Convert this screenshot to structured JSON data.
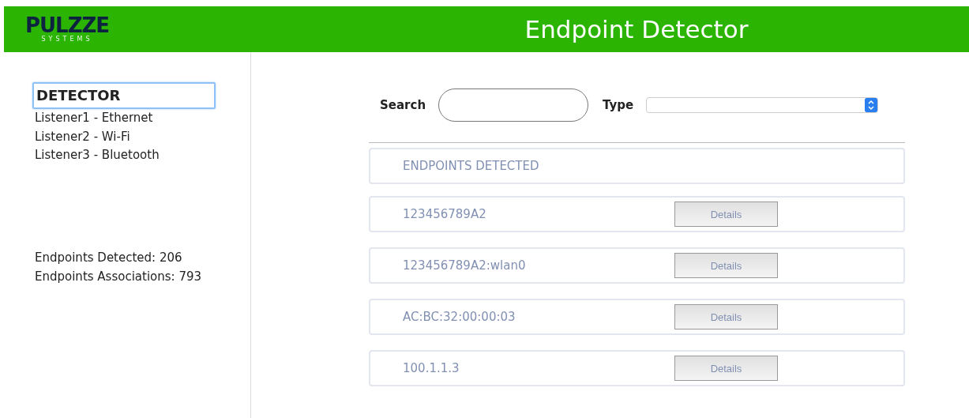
{
  "header": {
    "logo": {
      "name": "PULZZE",
      "tagline": "SYSTEMS"
    },
    "title": "Endpoint Detector"
  },
  "sidebar": {
    "items": [
      {
        "label": "DETECTOR",
        "selected": true
      },
      {
        "label": "Listener1 - Ethernet",
        "selected": false
      },
      {
        "label": "Listener2 - Wi-Fi",
        "selected": false
      },
      {
        "label": "Listener3 - Bluetooth",
        "selected": false
      }
    ],
    "stats": [
      "Endpoints Detected: 206",
      "Endpoints Associations: 793"
    ]
  },
  "filters": {
    "search_label": "Search",
    "type_label": "Type"
  },
  "list": {
    "heading": "ENDPOINTS DETECTED",
    "rows": [
      {
        "id": "123456789A2",
        "button": "Details"
      },
      {
        "id": "123456789A2:wlan0",
        "button": "Details"
      },
      {
        "id": "AC:BC:32:00:00:03",
        "button": "Details"
      },
      {
        "id": "100.1.1.3",
        "button": "Details"
      }
    ]
  }
}
